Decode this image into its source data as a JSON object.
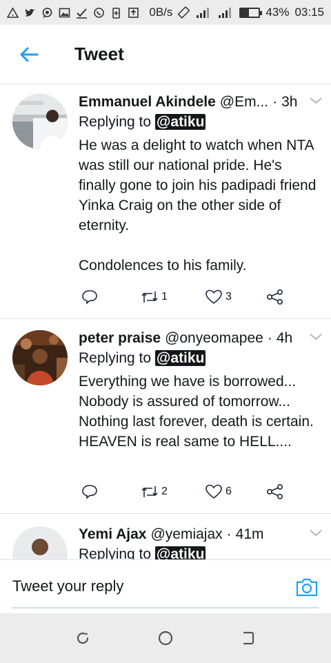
{
  "status_bar": {
    "net_speed": "0B/s",
    "battery_level": "43%",
    "battery_fraction": 0.43,
    "time": "03:15",
    "icons": [
      "alert-triangle-icon",
      "twitter-bird-icon",
      "chat-bubble-icon",
      "image-icon",
      "check-icon",
      "whatsapp-icon",
      "battery-saver-icon",
      "upload-icon",
      "rotate-icon",
      "signal-icon",
      "signal-icon",
      "battery-icon"
    ]
  },
  "header": {
    "title": "Tweet",
    "back_icon": "arrow-left-icon"
  },
  "colors": {
    "accent": "#1da1f2",
    "text": "#14171a",
    "divider": "#dde3e8",
    "system_bar": "#ececec"
  },
  "tweets": [
    {
      "name": "Emmanuel Akindele",
      "handle": "@Em...",
      "time": "3h",
      "replying_label": "Replying to",
      "mention": "@atiku",
      "text": "He was a delight to watch when NTA was still our national pride. He's finally gone to join his padipadi friend Yinka Craig on the other side of eternity.\n\nCondolences to his family.",
      "retweets": "1",
      "likes": "3"
    },
    {
      "name": "peter praise",
      "handle": "@onyeomapee",
      "time": "4h",
      "replying_label": "Replying to",
      "mention": "@atiku",
      "text": "Everything we have is borrowed... Nobody is assured of tomorrow... Nothing last forever, death is certain. HEAVEN is real same to HELL....",
      "retweets": "2",
      "likes": "6"
    },
    {
      "name": "Yemi Ajax",
      "handle": "@yemiajax",
      "time": "41m",
      "replying_label": "Replying to",
      "mention": "@atiku"
    }
  ],
  "composer": {
    "placeholder": "Tweet your reply",
    "camera_icon": "camera-icon"
  },
  "nav_bar": {
    "icons": [
      "recent-apps-icon",
      "home-circle-icon",
      "back-icon"
    ]
  }
}
